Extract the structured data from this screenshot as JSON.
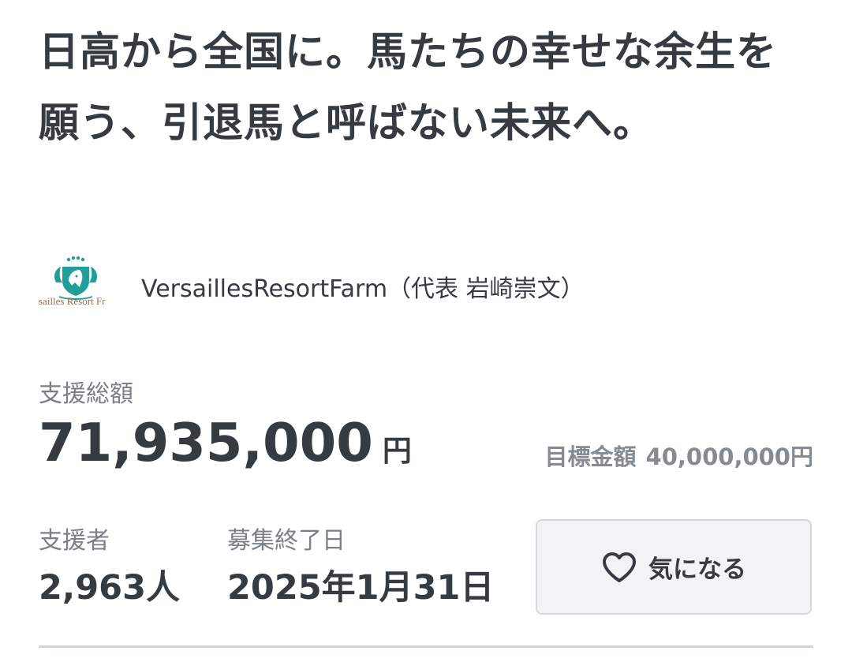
{
  "project": {
    "title": "日高から全国に。馬たちの幸せな余生を願う、引退馬と呼ばない未来へ。"
  },
  "owner": {
    "name": "VersaillesResortFarm（代表 岩崎崇文）",
    "logo_text": "sailles Resort Fr",
    "logo_icon": "horse-emblem-icon",
    "logo_color": "#1f9e9a"
  },
  "funding": {
    "total_label": "支援総額",
    "total_amount": "71,935,000",
    "total_unit": "円",
    "goal_label": "目標金額",
    "goal_amount": "40,000,000円"
  },
  "stats": {
    "supporters_label": "支援者",
    "supporters_value": "2,963人",
    "end_date_label": "募集終了日",
    "end_date_value": "2025年1月31日"
  },
  "favorite_button": {
    "label": "気になる",
    "icon": "heart-outline-icon"
  },
  "colors": {
    "text": "#353b40",
    "muted": "#7a8085",
    "button_bg": "#f1f3f5",
    "button_border": "#d5d9dd"
  }
}
